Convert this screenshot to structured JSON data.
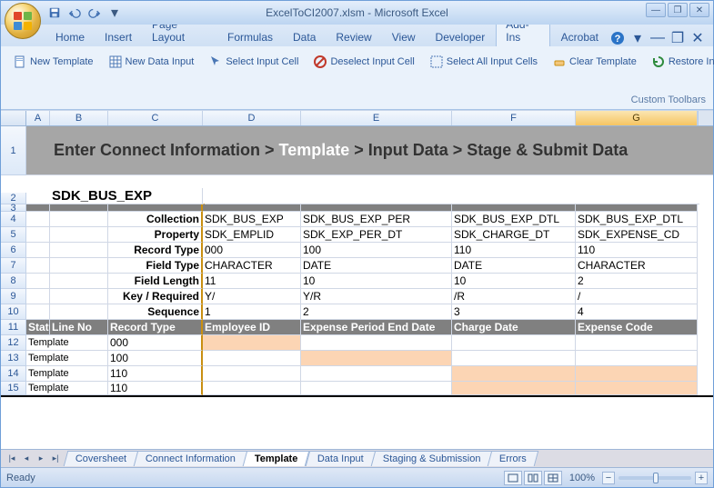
{
  "titlebar": {
    "title": "ExcelToCI2007.xlsm - Microsoft Excel"
  },
  "ribbon_tabs": [
    "Home",
    "Insert",
    "Page Layout",
    "Formulas",
    "Data",
    "Review",
    "View",
    "Developer",
    "Add-Ins",
    "Acrobat"
  ],
  "ribbon_active_index": 8,
  "toolbar": {
    "new_template": "New Template",
    "new_data_input": "New Data Input",
    "select_input_cell": "Select Input Cell",
    "deselect_input_cell": "Deselect Input Cell",
    "select_all_input_cells": "Select All Input Cells",
    "clear_template": "Clear Template",
    "restore_input": "Restore Input",
    "group_label": "Custom Toolbars"
  },
  "columns": [
    "A",
    "B",
    "C",
    "D",
    "E",
    "F",
    "G"
  ],
  "selected_column": "G",
  "row1": {
    "pre": "Enter Connect Information > ",
    "emph": "Template",
    "post": " > Input Data > Stage & Submit Data"
  },
  "row2_label": "SDK_BUS_EXP",
  "field_labels": {
    "collection": "Collection",
    "property": "Property",
    "record_type": "Record Type",
    "field_type": "Field Type",
    "field_length": "Field Length",
    "key_required": "Key / Required",
    "sequence": "Sequence"
  },
  "cols": {
    "D": {
      "collection": "SDK_BUS_EXP",
      "property": "SDK_EMPLID",
      "record_type": "000",
      "field_type": "CHARACTER",
      "field_length": "11",
      "key_required": "Y/",
      "sequence": "1",
      "header": "Employee ID"
    },
    "E": {
      "collection": "SDK_BUS_EXP_PER",
      "property": "SDK_EXP_PER_DT",
      "record_type": "100",
      "field_type": "DATE",
      "field_length": "10",
      "key_required": "Y/R",
      "sequence": "2",
      "header": "Expense Period End Date"
    },
    "F": {
      "collection": "SDK_BUS_EXP_DTL",
      "property": "SDK_CHARGE_DT",
      "record_type": "110",
      "field_type": "DATE",
      "field_length": "10",
      "key_required": "/R",
      "sequence": "3",
      "header": "Charge Date"
    },
    "G": {
      "collection": "SDK_BUS_EXP_DTL",
      "property": "SDK_EXPENSE_CD",
      "record_type": "110",
      "field_type": "CHARACTER",
      "field_length": "2",
      "key_required": "/",
      "sequence": "4",
      "header": "Expense Code"
    }
  },
  "row11": {
    "status": "Status",
    "lineno": "Line No",
    "record_type": "Record Type"
  },
  "templates": [
    {
      "status": "Template",
      "record_type": "000",
      "highlight": "D"
    },
    {
      "status": "Template",
      "record_type": "100",
      "highlight": "E"
    },
    {
      "status": "Template",
      "record_type": "110",
      "highlight": "FG"
    },
    {
      "status": "Template",
      "record_type": "110",
      "highlight": "FG"
    }
  ],
  "sheet_tabs": [
    "Coversheet",
    "Connect Information",
    "Template",
    "Data Input",
    "Staging & Submission",
    "Errors"
  ],
  "active_sheet_index": 2,
  "status": {
    "ready": "Ready",
    "zoom": "100%"
  }
}
